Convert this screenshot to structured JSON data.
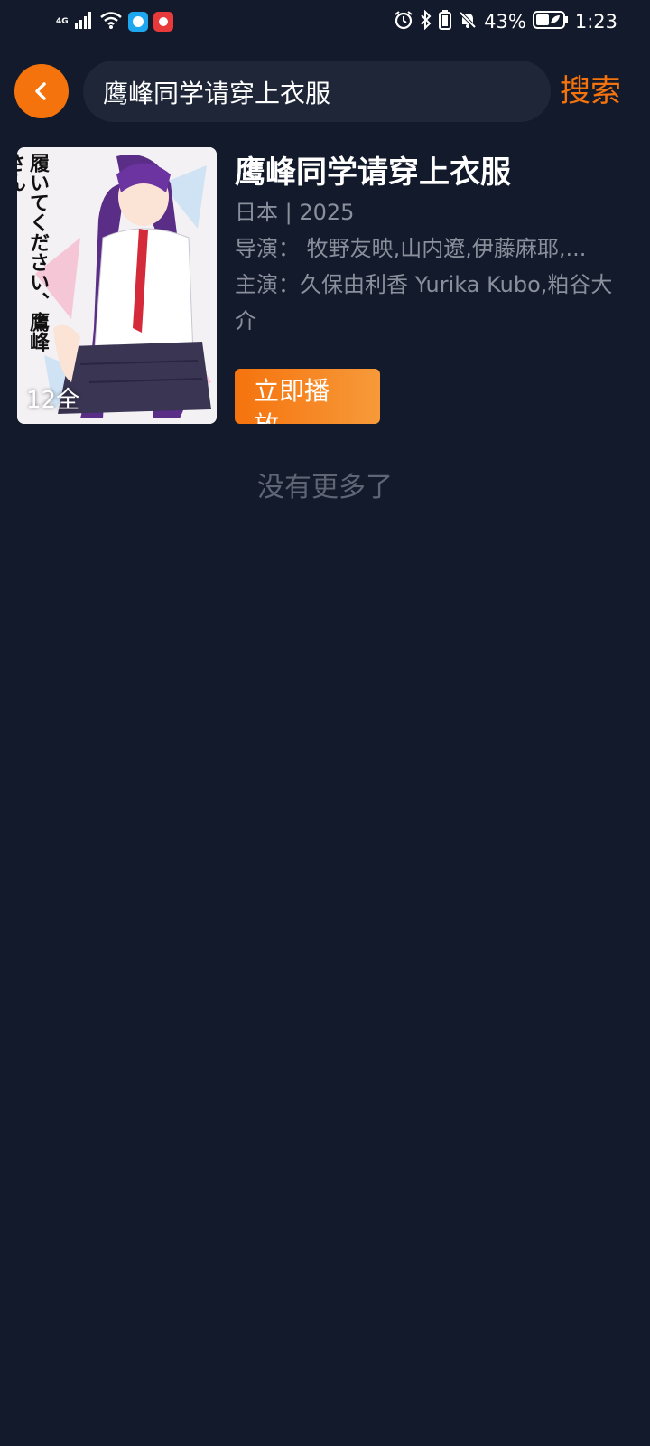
{
  "status_bar": {
    "network_label": "4G",
    "battery_percent": "43%",
    "time": "1:23"
  },
  "search": {
    "query": "鹰峰同学请穿上衣服",
    "button_label": "搜索"
  },
  "results": [
    {
      "title": "鹰峰同学请穿上衣服",
      "region_year": "日本 | 2025",
      "director": "导演： 牧野友映,山内遼,伊藤麻耶,...",
      "cast": "主演：久保由利香 Yurika Kubo,粕谷大介",
      "episodes": "12全",
      "poster_title": "履いてください、鷹峰さん",
      "play_label": "立即播放"
    }
  ],
  "footer": {
    "no_more": "没有更多了"
  },
  "colors": {
    "accent": "#f5730d",
    "background": "#131a2b",
    "search_bg": "#1e2638"
  }
}
